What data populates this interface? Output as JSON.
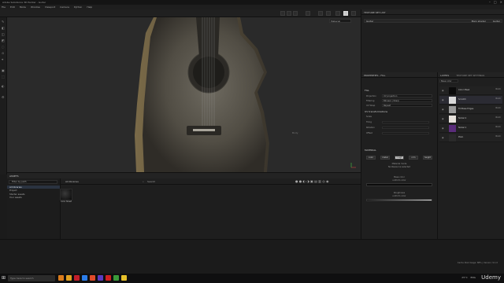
{
  "window": {
    "title": "Adobe Substance 3D Painter - Guitar"
  },
  "menu": [
    "File",
    "Edit",
    "Mode",
    "Window",
    "Viewport",
    "Camera",
    "Python",
    "Help"
  ],
  "viewport": {
    "dropdown": "Material",
    "center_text": "Body"
  },
  "texture_set_list": {
    "title": "TEXTURE SET LIST",
    "set_name": "Guitar",
    "right_a": "Main shader",
    "right_b": "Guitar"
  },
  "properties": {
    "title": "PROPERTIES - FILL",
    "fill_section": "FILL",
    "projection_label": "Projection",
    "projection_value": "UV projection",
    "filtering_label": "Filtering",
    "filtering_value": "Bilinear | Sharp",
    "uvwrap_label": "UV Wrap",
    "uvwrap_value": "Repeat",
    "uvt_section": "UV transformations",
    "scale_label": "Scale",
    "tiling_label": "Tiling",
    "rotation_label": "Rotation",
    "offset_label": "Offset",
    "material_section": "MATERIAL",
    "mat_buttons": [
      "color",
      "metal",
      "rough",
      "nrm",
      "height"
    ],
    "material_mode": "Material mode",
    "no_resource": "No Resource selected",
    "base_color": "Base color",
    "uniform_color": "uniform color",
    "roughness": "Roughness",
    "roughness_value": "uniform color"
  },
  "layers": {
    "title": "LAYERS",
    "tab2": "TEXTURE SET SETTINGS",
    "blend_dropdown": "Base color",
    "rows": [
      {
        "name": "Color Mask",
        "blend": "Norm",
        "thumb": "#0b0b0b"
      },
      {
        "name": "Scratch",
        "blend": "Norm",
        "thumb": "#d9d9d9"
      },
      {
        "name": "Fill Base Edges",
        "blend": "Norm",
        "thumb": "#9a9a9a"
      },
      {
        "name": "Nickel 2",
        "blend": "Norm",
        "thumb": "#e7e2dc"
      },
      {
        "name": "Nickel 1",
        "blend": "Norm",
        "thumb": "#5a2c7a"
      },
      {
        "name": "Plain",
        "blend": "Norm",
        "thumb": "#2a2a2a"
      }
    ]
  },
  "assets": {
    "title": "ASSETS",
    "filter_placeholder": "Filter by path",
    "tree": [
      "All libraries",
      "Project",
      "Starter assets",
      "Your assets"
    ],
    "breadcrumb": "All libraries",
    "search_placeholder": "Search",
    "tile_label": "Color Sheet"
  },
  "status": {
    "message": "Cache Disk Usage: 88% | Version: 9.1.0"
  },
  "taskbar": {
    "search_placeholder": "Type here to search",
    "tray_temp": "25°C",
    "tray_lang": "ENG",
    "brand": "Udemy"
  }
}
